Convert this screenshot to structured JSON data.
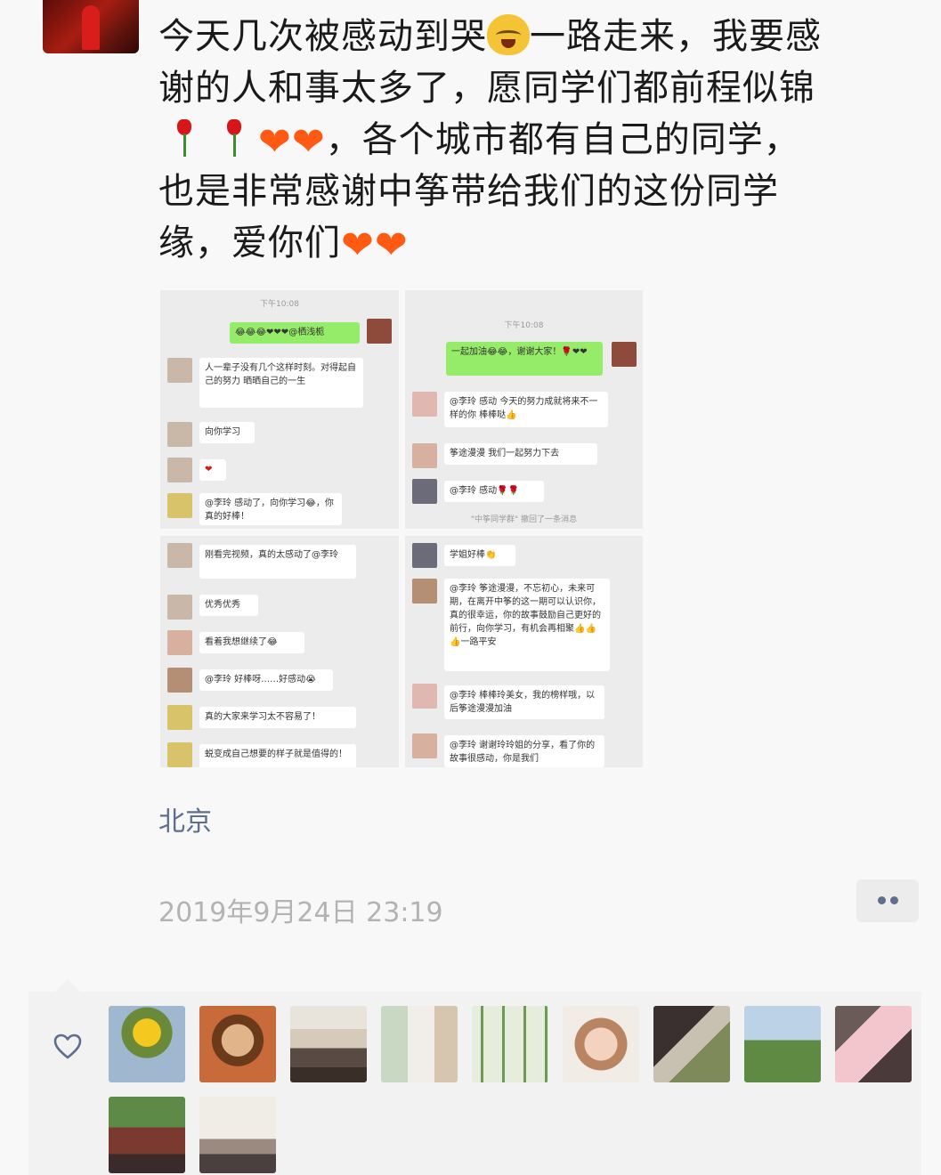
{
  "moment": {
    "lines": [
      {
        "t1": "今天几次被感动到哭",
        "t2": "一路走来，我要感"
      },
      {
        "t1": "谢的人和事太多了，愿同学们都前程似锦"
      },
      {
        "t1": "，各个城市都有自己的同学，"
      },
      {
        "t1": "也是非常感谢中筝带给我们的这份同学"
      },
      {
        "t1": "缘，爱你们"
      }
    ],
    "emoji": {
      "cat": "cat-crying-laughing-emoji",
      "rose": "rose-emoji",
      "heart": "orange-heart-emoji"
    }
  },
  "screenshots": {
    "shot1": {
      "time": "下午10:08",
      "msg_mine": "😂😂😂❤❤❤@栖浅栀",
      "msg1": "人一辈子没有几个这样时刻。对得起自己的努力 晒晒自己的一生",
      "msg2": "向你学习",
      "msg3": "❤",
      "msg4": "@李玲 感动了，向你学习😂，你真的好棒！"
    },
    "shot2": {
      "time": "下午10:08",
      "msg_mine": "一起加油😂😂，谢谢大家！🌹❤❤",
      "msg1": "@李玲 感动 今天的努力成就将来不一样的你 棒棒哒👍",
      "msg2": "筝途漫漫 我们一起努力下去",
      "msg3": "@李玲 感动🌹🌹",
      "notice": "\"中筝同学群\" 撤回了一条消息"
    },
    "shot3": {
      "msg1": "刚看完视频，真的太感动了@李玲",
      "msg2": "优秀优秀",
      "msg3": "看着我想继续了😂",
      "msg4": "@李玲 好棒呀……好感动😭",
      "msg5": "真的大家来学习太不容易了！",
      "msg6": "蜕变成自己想要的样子就是值得的！"
    },
    "shot4": {
      "msg1": "学姐好棒👏",
      "msg2": "@李玲 筝途漫漫，不忘初心，未来可期，在离开中筝的这一期可以认识你，真的很幸运，你的故事鼓励自己更好的前行，向你学习，有机会再相聚👍👍👍一路平安",
      "msg3": "@李玲 棒棒玲美女，我的榜样哦，以后筝途漫漫加油",
      "msg4": "@李玲 谢谢玲玲姐的分享，看了你的故事很感动，你是我们"
    }
  },
  "location": "北京",
  "timestamp": "2019年9月24日 23:19",
  "colors": {
    "link": "#5e6e8c",
    "heart": "#ff5a14",
    "wechat_green": "#95ec69"
  }
}
